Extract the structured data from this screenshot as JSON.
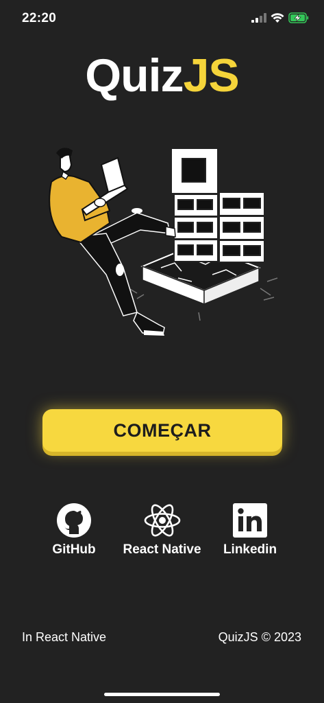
{
  "status_bar": {
    "time": "22:20",
    "icons": [
      "cellular-signal-icon",
      "wifi-icon",
      "battery-charging-icon"
    ],
    "battery_color": "#34c759"
  },
  "title": {
    "main": "Quiz",
    "accent": "JS",
    "accent_color": "#f5d43a"
  },
  "illustration": {
    "icon": "person-with-laptop-kicking-blocks-illustration"
  },
  "start_button": {
    "label": "COMEÇAR",
    "color": "#f7d83f"
  },
  "links": {
    "github": {
      "label": "GitHub",
      "icon": "github-icon"
    },
    "react_native": {
      "label": "React Native",
      "icon": "react-icon"
    },
    "linkedin": {
      "label": "Linkedin",
      "icon": "linkedin-icon"
    }
  },
  "footer": {
    "left": "In React Native",
    "right": "QuizJS © 2023"
  },
  "colors": {
    "background": "#222222",
    "text": "#ffffff"
  }
}
